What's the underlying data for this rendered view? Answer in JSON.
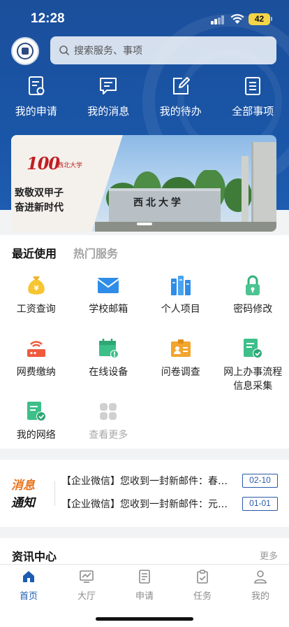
{
  "status_bar": {
    "time": "12:28",
    "battery": "42"
  },
  "search": {
    "placeholder": "搜索服务、事项"
  },
  "quick_actions": [
    {
      "label": "我的申请",
      "icon": "application-doc-icon"
    },
    {
      "label": "我的消息",
      "icon": "message-icon"
    },
    {
      "label": "我的待办",
      "icon": "edit-todo-icon"
    },
    {
      "label": "全部事项",
      "icon": "list-icon"
    }
  ],
  "banner": {
    "logo_text": "100",
    "logo_sub": "西北大学",
    "slogan_line1": "致敬双甲子",
    "slogan_line2": "奋进新时代",
    "gate_text": "西北大学"
  },
  "services": {
    "tabs": [
      {
        "label": "最近使用",
        "active": true
      },
      {
        "label": "热门服务",
        "active": false
      }
    ],
    "items": [
      {
        "label": "工资查询",
        "icon": "money-bag-icon"
      },
      {
        "label": "学校邮箱",
        "icon": "mail-icon"
      },
      {
        "label": "个人项目",
        "icon": "project-books-icon"
      },
      {
        "label": "密码修改",
        "icon": "lock-icon"
      },
      {
        "label": "网费缴纳",
        "icon": "router-icon"
      },
      {
        "label": "在线设备",
        "icon": "device-calendar-icon"
      },
      {
        "label": "问卷调查",
        "icon": "survey-card-icon"
      },
      {
        "label": "网上办事流程信息采集",
        "icon": "checklist-doc-icon"
      },
      {
        "label": "我的网络",
        "icon": "network-doc-icon"
      },
      {
        "label": "查看更多",
        "icon": "more-grid-icon"
      }
    ]
  },
  "notice": {
    "brand_line1": "消息",
    "brand_line2": "通知",
    "items": [
      {
        "text": "【企业微信】您收到一封新邮件：春…",
        "date": "02-10"
      },
      {
        "text": "【企业微信】您收到一封新邮件：元…",
        "date": "01-01"
      }
    ]
  },
  "news": {
    "title": "资讯中心",
    "more": "更多"
  },
  "tabbar": [
    {
      "label": "首页",
      "icon": "home-icon",
      "active": true
    },
    {
      "label": "大厅",
      "icon": "hall-icon",
      "active": false
    },
    {
      "label": "申请",
      "icon": "apply-icon",
      "active": false
    },
    {
      "label": "任务",
      "icon": "task-icon",
      "active": false
    },
    {
      "label": "我的",
      "icon": "profile-icon",
      "active": false
    }
  ],
  "colors": {
    "primary": "#1d5cb0",
    "accent_orange": "#e8731e"
  }
}
